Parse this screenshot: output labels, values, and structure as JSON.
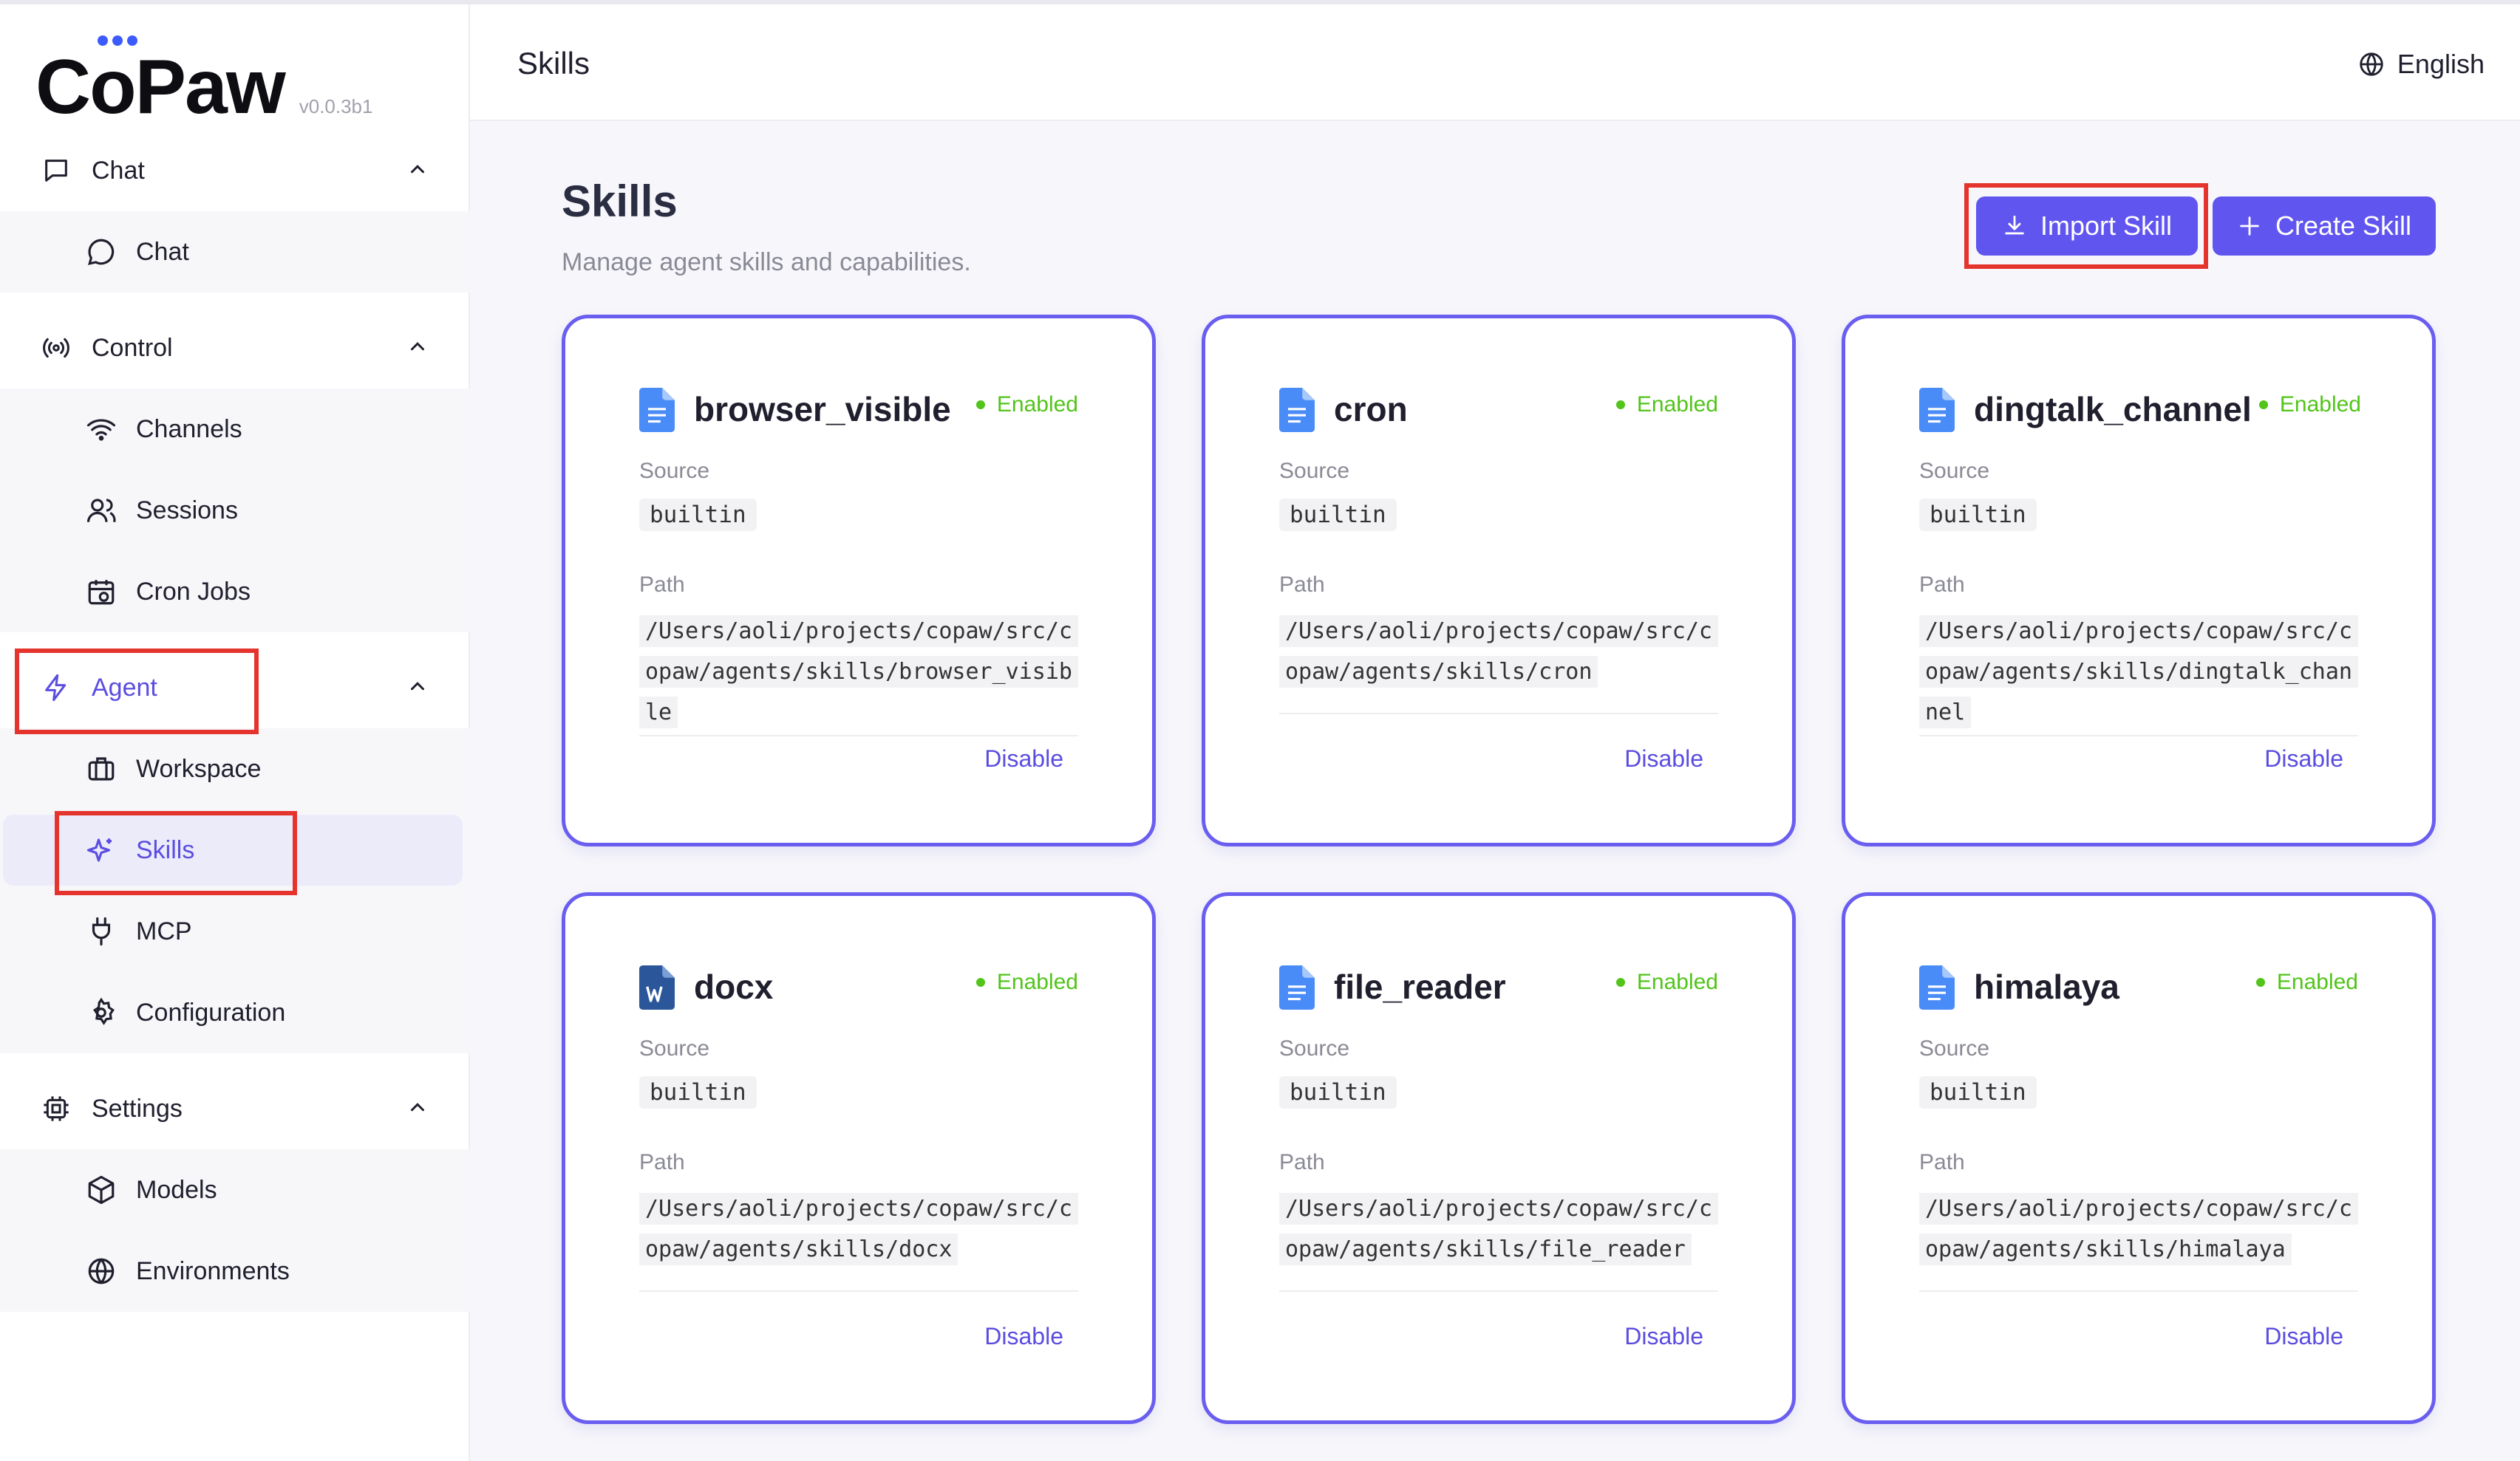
{
  "app": {
    "logo": "CoPaw",
    "version": "v0.0.3b1"
  },
  "colors": {
    "accent": "#6155f0",
    "enabled": "#52c41a",
    "highlight": "#e5342d",
    "doc_blue": "#4a8cf7",
    "doc_word": "#2b579a"
  },
  "sidebar": {
    "groups": [
      {
        "label": "Chat",
        "icon": "message-square-icon",
        "expanded": true,
        "items": [
          {
            "label": "Chat",
            "icon": "chat-bubble-icon"
          }
        ]
      },
      {
        "label": "Control",
        "icon": "broadcast-icon",
        "expanded": true,
        "items": [
          {
            "label": "Channels",
            "icon": "wifi-icon"
          },
          {
            "label": "Sessions",
            "icon": "users-icon"
          },
          {
            "label": "Cron Jobs",
            "icon": "calendar-clock-icon"
          }
        ]
      },
      {
        "label": "Agent",
        "icon": "lightning-icon",
        "expanded": true,
        "items": [
          {
            "label": "Workspace",
            "icon": "briefcase-icon"
          },
          {
            "label": "Skills",
            "icon": "sparkles-icon",
            "selected": true
          },
          {
            "label": "MCP",
            "icon": "plug-icon"
          },
          {
            "label": "Configuration",
            "icon": "gear-icon"
          }
        ]
      },
      {
        "label": "Settings",
        "icon": "cpu-icon",
        "expanded": true,
        "items": [
          {
            "label": "Models",
            "icon": "cube-icon"
          },
          {
            "label": "Environments",
            "icon": "globe-icon"
          }
        ]
      }
    ]
  },
  "header": {
    "title": "Skills",
    "language": "English"
  },
  "main": {
    "title": "Skills",
    "subtitle": "Manage agent skills and capabilities.",
    "import_label": "Import Skill",
    "create_label": "Create Skill",
    "source_label": "Source",
    "path_label": "Path",
    "skills": [
      {
        "name": "browser_visible",
        "status": "Enabled",
        "source": "builtin",
        "path": "/Users/aoli/projects/copaw/src/copaw/agents/skills/browser_visible",
        "action": "Disable",
        "icon": "document-icon"
      },
      {
        "name": "cron",
        "status": "Enabled",
        "source": "builtin",
        "path": "/Users/aoli/projects/copaw/src/copaw/agents/skills/cron",
        "action": "Disable",
        "icon": "document-icon"
      },
      {
        "name": "dingtalk_channel",
        "status": "Enabled",
        "source": "builtin",
        "path": "/Users/aoli/projects/copaw/src/copaw/agents/skills/dingtalk_channel",
        "action": "Disable",
        "icon": "document-icon"
      },
      {
        "name": "docx",
        "status": "Enabled",
        "source": "builtin",
        "path": "/Users/aoli/projects/copaw/src/copaw/agents/skills/docx",
        "action": "Disable",
        "icon": "word-document-icon"
      },
      {
        "name": "file_reader",
        "status": "Enabled",
        "source": "builtin",
        "path": "/Users/aoli/projects/copaw/src/copaw/agents/skills/file_reader",
        "action": "Disable",
        "icon": "document-icon"
      },
      {
        "name": "himalaya",
        "status": "Enabled",
        "source": "builtin",
        "path": "/Users/aoli/projects/copaw/src/copaw/agents/skills/himalaya",
        "action": "Disable",
        "icon": "document-icon"
      }
    ]
  }
}
